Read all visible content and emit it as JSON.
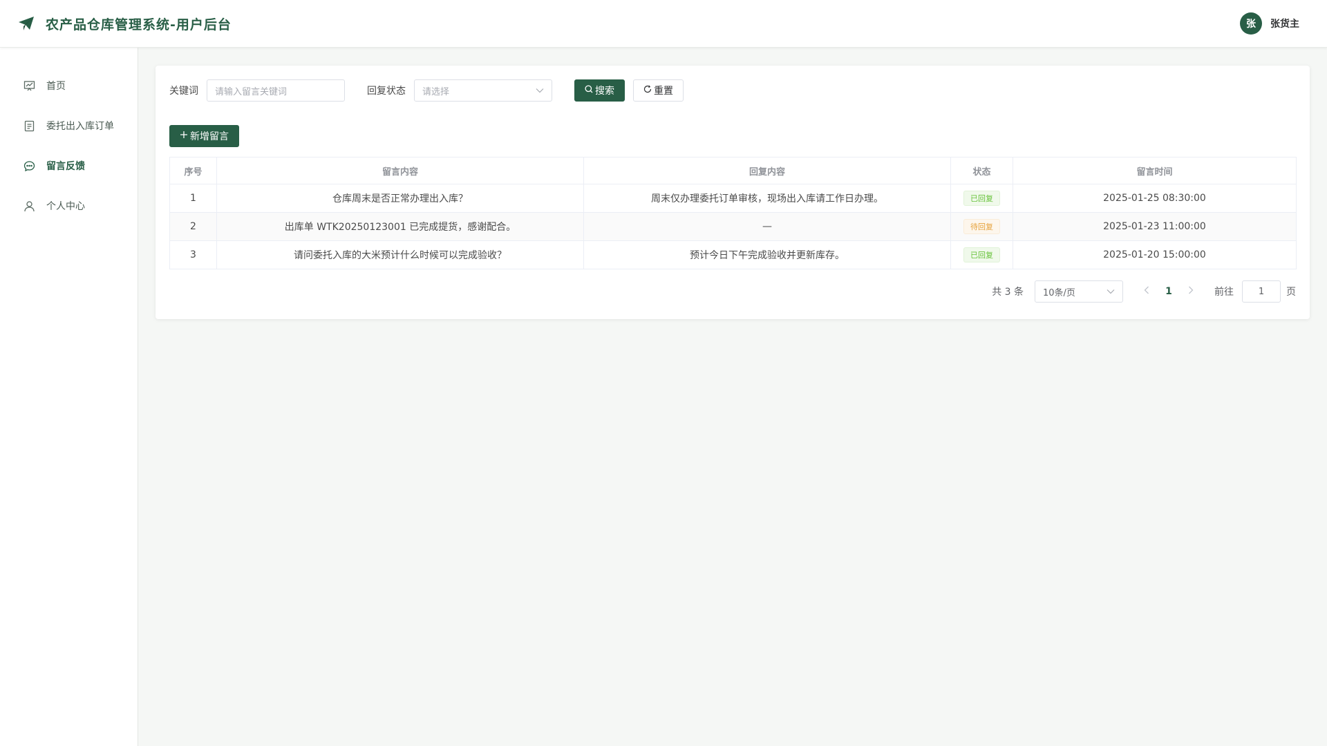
{
  "header": {
    "title": "农产品仓库管理系统-用户后台",
    "user_avatar": "张",
    "user_name": "张货主"
  },
  "sidebar": {
    "items": [
      {
        "label": "首页",
        "icon": "dashboard-icon",
        "active": false
      },
      {
        "label": "委托出入库订单",
        "icon": "document-icon",
        "active": false
      },
      {
        "label": "留言反馈",
        "icon": "chat-icon",
        "active": true
      },
      {
        "label": "个人中心",
        "icon": "user-icon",
        "active": false
      }
    ]
  },
  "filters": {
    "keyword_label": "关键词",
    "keyword_placeholder": "请输入留言关键词",
    "status_label": "回复状态",
    "status_placeholder": "请选择",
    "search_label": "搜索",
    "reset_label": "重置"
  },
  "actions": {
    "add_label": "新增留言"
  },
  "table": {
    "columns": [
      "序号",
      "留言内容",
      "回复内容",
      "状态",
      "留言时间"
    ],
    "rows": [
      {
        "index": "1",
        "content": "仓库周末是否正常办理出入库？",
        "reply": "周末仅办理委托订单审核，现场出入库请工作日办理。",
        "status": "已回复",
        "time": "2025-01-25 08:30:00"
      },
      {
        "index": "2",
        "content": "出库单 WTK20250123001 已完成提货，感谢配合。",
        "reply": "—",
        "status": "待回复",
        "time": "2025-01-23 11:00:00"
      },
      {
        "index": "3",
        "content": "请问委托入库的大米预计什么时候可以完成验收？",
        "reply": "预计今日下午完成验收并更新库存。",
        "status": "已回复",
        "time": "2025-01-20 15:00:00"
      }
    ]
  },
  "pagination": {
    "total_text": "共 3 条",
    "page_size": "10条/页",
    "current_page": "1",
    "goto_label": "前往",
    "goto_value": "1",
    "page_unit": "页"
  },
  "colors": {
    "brand": "#285e46",
    "replied": "#67c23a",
    "pending": "#e6a23c"
  }
}
